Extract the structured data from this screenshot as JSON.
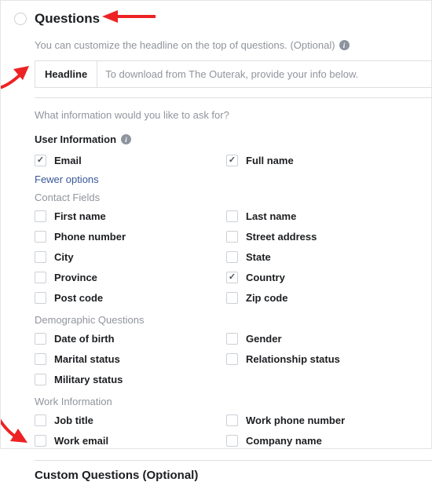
{
  "header": {
    "title": "Questions",
    "subtext": "You can customize the headline on the top of questions. (Optional)"
  },
  "headline": {
    "label": "Headline",
    "value": "To download from The Outerak, provide your info below."
  },
  "ask_prompt": "What information would you like to ask for?",
  "user_info_label": "User Information",
  "top_checks": {
    "email": "Email",
    "fullname": "Full name"
  },
  "fewer_options": "Fewer options",
  "groups": {
    "contact": {
      "label": "Contact Fields",
      "left": [
        "First name",
        "Phone number",
        "City",
        "Province",
        "Post code"
      ],
      "right": [
        "Last name",
        "Street address",
        "State",
        "Country",
        "Zip code"
      ],
      "right_checked": [
        false,
        false,
        false,
        true,
        false
      ]
    },
    "demo": {
      "label": "Demographic Questions",
      "left": [
        "Date of birth",
        "Marital status",
        "Military status"
      ],
      "right": [
        "Gender",
        "Relationship status"
      ]
    },
    "work": {
      "label": "Work Information",
      "left": [
        "Job title",
        "Work email"
      ],
      "right": [
        "Work phone number",
        "Company name"
      ]
    }
  },
  "custom_label": "Custom Questions (Optional)"
}
